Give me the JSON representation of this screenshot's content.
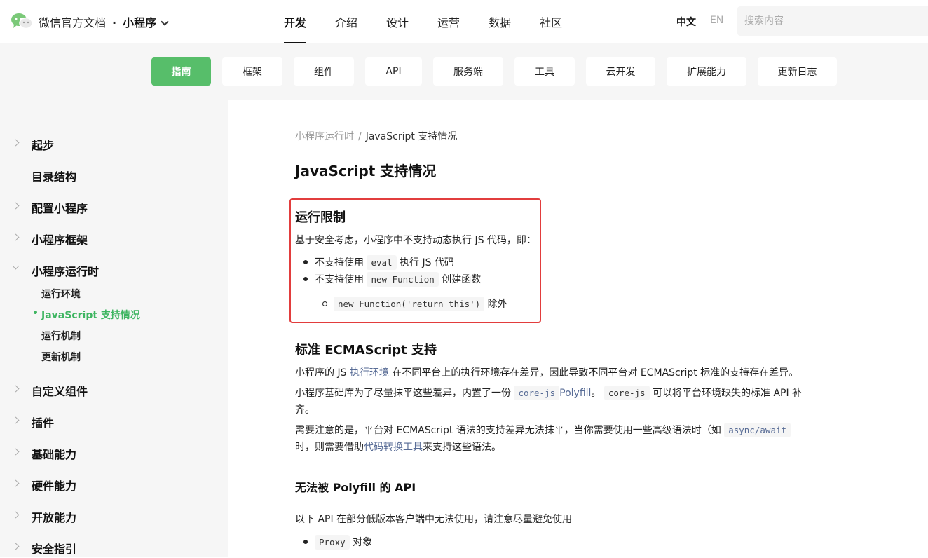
{
  "header": {
    "brand": "微信官方文档",
    "separator": "·",
    "product": "小程序",
    "nav": [
      "开发",
      "介绍",
      "设计",
      "运营",
      "数据",
      "社区"
    ],
    "active_nav": "开发",
    "lang_zh": "中文",
    "lang_en": "EN",
    "search_placeholder": "搜索内容"
  },
  "subnav": {
    "items": [
      "指南",
      "框架",
      "组件",
      "API",
      "服务端",
      "工具",
      "云开发",
      "扩展能力",
      "更新日志"
    ],
    "active": "指南"
  },
  "sidebar": {
    "items": [
      {
        "label": "起步",
        "expandable": true
      },
      {
        "label": "目录结构",
        "expandable": false
      },
      {
        "label": "配置小程序",
        "expandable": true
      },
      {
        "label": "小程序框架",
        "expandable": true
      },
      {
        "label": "小程序运行时",
        "expandable": true,
        "expanded": true
      },
      {
        "label": "自定义组件",
        "expandable": true
      },
      {
        "label": "插件",
        "expandable": true
      },
      {
        "label": "基础能力",
        "expandable": true
      },
      {
        "label": "硬件能力",
        "expandable": true
      },
      {
        "label": "开放能力",
        "expandable": true
      },
      {
        "label": "安全指引",
        "expandable": true
      }
    ],
    "runtime_children": [
      "运行环境",
      "JavaScript 支持情况",
      "运行机制",
      "更新机制"
    ],
    "active_child": "JavaScript 支持情况",
    "active_bullet": "•"
  },
  "breadcrumb": {
    "parent": "小程序运行时",
    "separator": "/",
    "current": "JavaScript 支持情况"
  },
  "article": {
    "title": "JavaScript 支持情况",
    "restriction": {
      "heading": "运行限制",
      "intro": "基于安全考虑，小程序中不支持动态执行 JS 代码，即：",
      "item1_pre": "不支持使用",
      "item1_code": "eval",
      "item1_post": "执行 JS 代码",
      "item2_pre": "不支持使用",
      "item2_code": "new Function",
      "item2_post": "创建函数",
      "subitem_code": "new Function('return this')",
      "subitem_post": "除外"
    },
    "ecma": {
      "heading": "标准 ECMAScript 支持",
      "p1_pre": "小程序的 JS",
      "p1_link": "执行环境",
      "p1_post": "在不同平台上的执行环境存在差异，因此导致不同平台对 ECMAScript 标准的支持存在差异。",
      "p2_pre": "小程序基础库为了尽量抹平这些差异，内置了一份",
      "p2_code1": "core-js",
      "p2_link": "Polyfill",
      "p2_mid": "。",
      "p2_code2": "core-js",
      "p2_post": "可以将平台环境缺失的标准 API 补",
      "p2_cont": "齐。",
      "p3_pre": "需要注意的是，平台对 ECMAScript 语法的支持差异无法抹平，当你需要使用一些高级语法时（如",
      "p3_code": "async/await",
      "p3_line2_pre": "时，则需要借助",
      "p3_link": "代码转换工具",
      "p3_line2_post": "来支持这些语法。"
    },
    "polyfill": {
      "heading": "无法被 Polyfill 的 API",
      "intro": "以下 API 在部分低版本客户端中无法使用，请注意尽量避免使用",
      "item1_code": "Proxy",
      "item1_post": "对象"
    }
  },
  "colors": {
    "accent_green": "#57be6a",
    "link": "#576b95",
    "highlight_border": "#e23d3d"
  },
  "icons": {
    "logo": "wechat-logo-icon"
  }
}
